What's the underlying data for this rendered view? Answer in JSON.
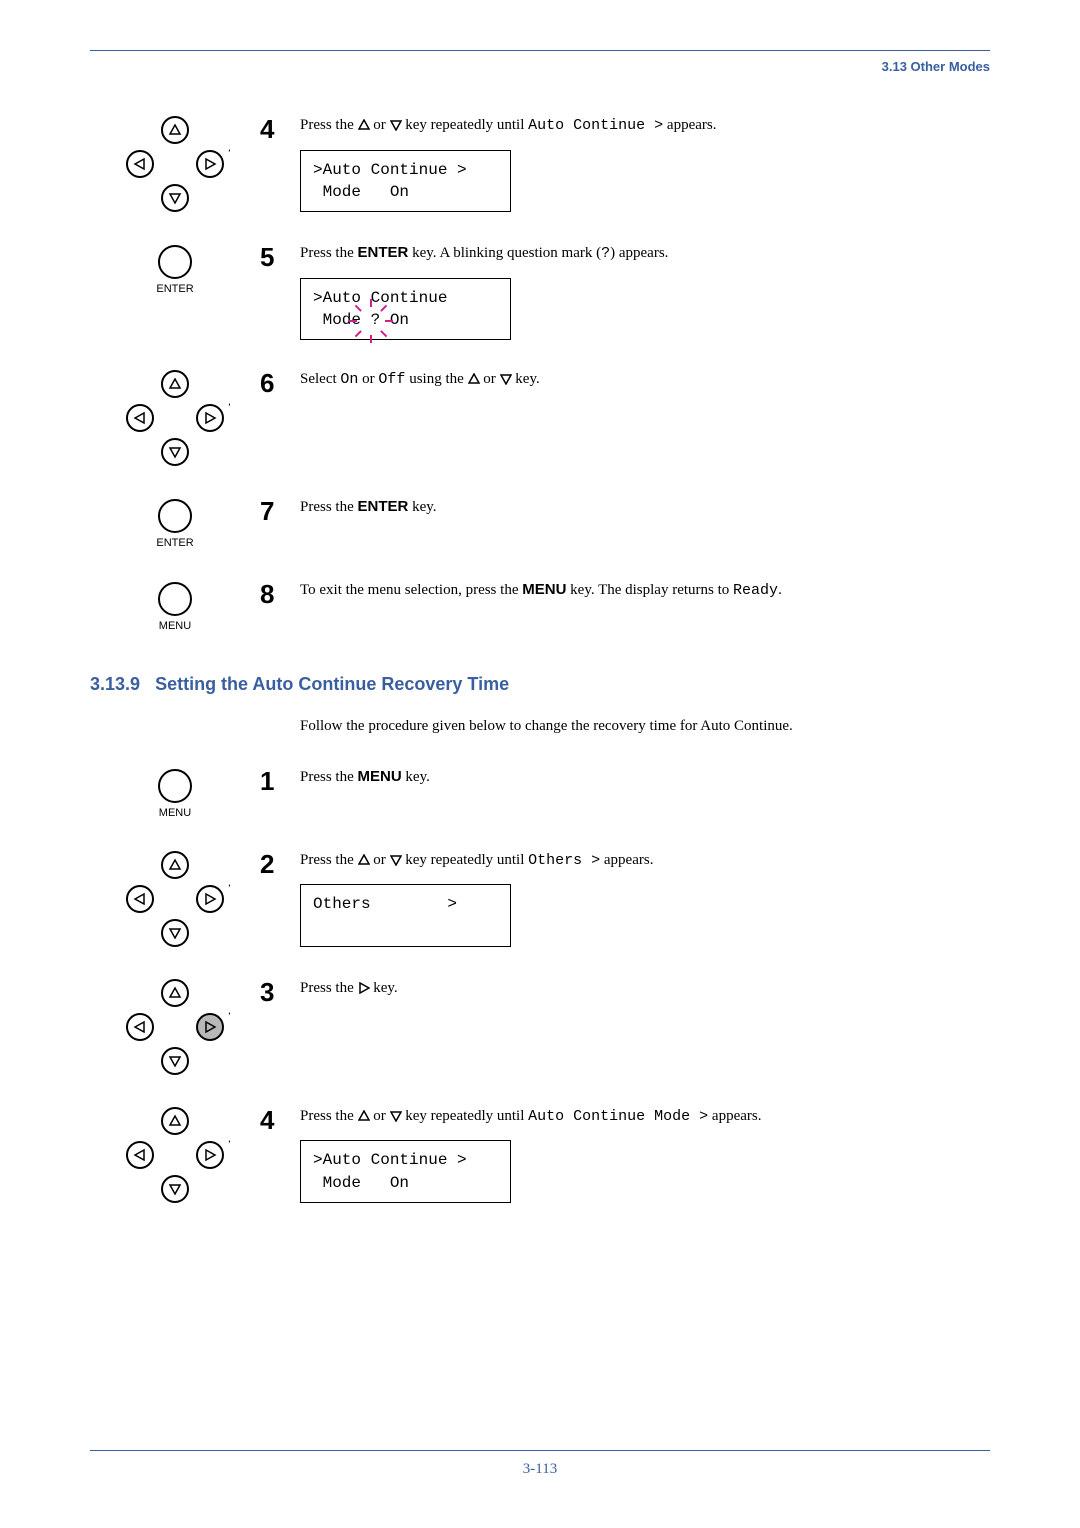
{
  "header": {
    "section": "3.13 Other Modes"
  },
  "stepsA": [
    {
      "num": "4",
      "icon": "dpad",
      "text_parts": [
        "Press the ",
        "△",
        " or ",
        "▽",
        " key repeatedly until ",
        "Auto Continue >",
        " appears."
      ],
      "lcd": ">Auto Continue >\n Mode   On"
    },
    {
      "num": "5",
      "icon": "enter",
      "text_parts": [
        "Press the ",
        "ENTER",
        " key. A blinking question mark (",
        "?",
        ") appears."
      ],
      "lcd_blink": {
        "pre": ">Auto Continue\n Mode ",
        "blink": "?",
        "post": " On"
      }
    },
    {
      "num": "6",
      "icon": "dpad",
      "text_parts": [
        "Select ",
        "On",
        " or ",
        "Off",
        " using the ",
        "△",
        " or ",
        "▽",
        " key."
      ]
    },
    {
      "num": "7",
      "icon": "enter",
      "text_parts": [
        " Press the ",
        "ENTER",
        " key."
      ]
    },
    {
      "num": "8",
      "icon": "menu",
      "text_parts": [
        "To exit the menu selection, press the ",
        "MENU",
        " key. The display returns to ",
        "Ready",
        "."
      ]
    }
  ],
  "section": {
    "number": "3.13.9",
    "title": "Setting the Auto Continue Recovery Time",
    "intro": "Follow the procedure given below to change the recovery time for Auto Continue."
  },
  "stepsB": [
    {
      "num": "1",
      "icon": "menu",
      "text_parts": [
        "Press the ",
        "MENU",
        " key."
      ]
    },
    {
      "num": "2",
      "icon": "dpad",
      "text_parts": [
        "Press the ",
        "△",
        " or ",
        "▽",
        " key repeatedly until ",
        "Others >",
        " appears."
      ],
      "lcd": "Others        >\n "
    },
    {
      "num": "3",
      "icon": "dpad-right",
      "text_parts": [
        "Press the ",
        "▷",
        " key."
      ]
    },
    {
      "num": "4",
      "icon": "dpad",
      "text_parts": [
        "Press the ",
        "△",
        " or ",
        "▽",
        " key repeatedly until ",
        "Auto Continue Mode >",
        " appears."
      ],
      "lcd": ">Auto Continue >\n Mode   On"
    }
  ],
  "labels": {
    "enter": "ENTER",
    "menu": "MENU",
    "qmark": "?"
  },
  "pageNumber": "3-113"
}
